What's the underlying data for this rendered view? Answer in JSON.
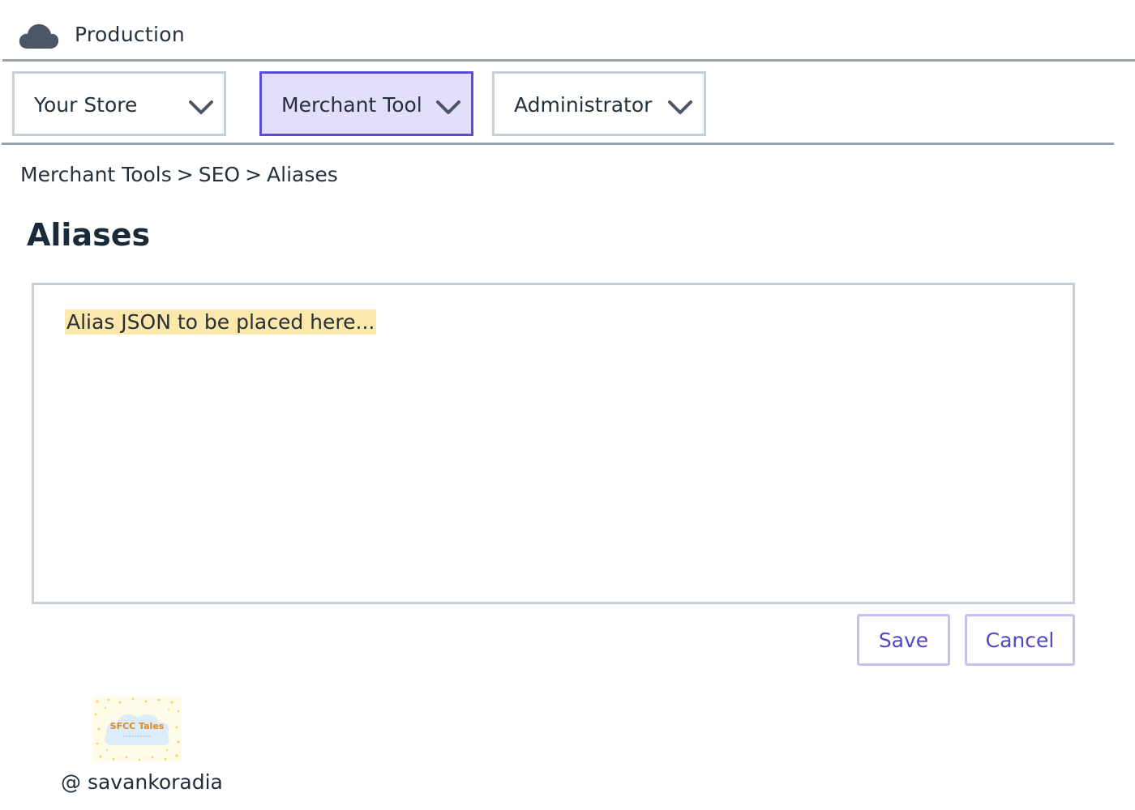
{
  "header": {
    "environment": "Production",
    "icon": "cloud-icon"
  },
  "nav": {
    "dropdowns": [
      {
        "label": "Your Store",
        "active": false
      },
      {
        "label": "Merchant Tool",
        "active": true
      },
      {
        "label": "Administrator",
        "active": false
      }
    ]
  },
  "breadcrumb": {
    "items": [
      "Merchant Tools",
      "SEO",
      "Aliases"
    ],
    "separator": ">"
  },
  "page": {
    "title": "Aliases"
  },
  "editor": {
    "placeholder": "Alias JSON to be placed here..."
  },
  "actions": {
    "save_label": "Save",
    "cancel_label": "Cancel"
  },
  "footer": {
    "logo_text": "SFCC Tales",
    "handle": "@ savankoradia"
  },
  "colors": {
    "accent": "#5b4ed6",
    "active_bg": "#e2defb",
    "highlight": "#fbe8ad",
    "button_text": "#5145c8",
    "border": "#c7cfd8"
  }
}
